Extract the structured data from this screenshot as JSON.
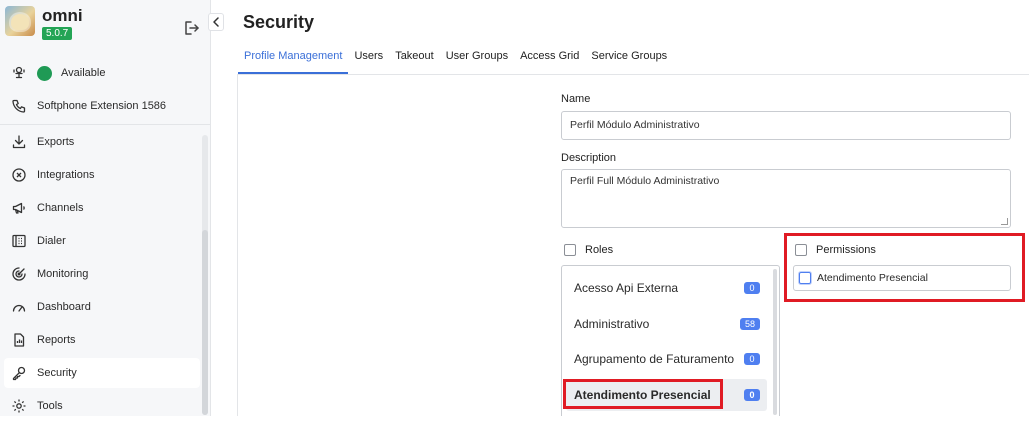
{
  "app": {
    "name": "omni",
    "version": "5.0.7"
  },
  "sidebar": {
    "status": {
      "label": "Available",
      "color": "#1f9a55"
    },
    "extension": {
      "label": "Softphone Extension 1586"
    },
    "items": [
      {
        "label": "Exports",
        "icon": "download-icon"
      },
      {
        "label": "Integrations",
        "icon": "integrations-icon"
      },
      {
        "label": "Channels",
        "icon": "megaphone-icon"
      },
      {
        "label": "Dialer",
        "icon": "dialer-icon"
      },
      {
        "label": "Monitoring",
        "icon": "monitoring-icon"
      },
      {
        "label": "Dashboard",
        "icon": "dashboard-icon"
      },
      {
        "label": "Reports",
        "icon": "reports-icon"
      },
      {
        "label": "Security",
        "icon": "key-icon",
        "active": true
      },
      {
        "label": "Tools",
        "icon": "gear-icon"
      }
    ]
  },
  "page": {
    "title": "Security",
    "tabs": [
      {
        "label": "Profile Management",
        "active": true
      },
      {
        "label": "Users"
      },
      {
        "label": "Takeout"
      },
      {
        "label": "User Groups"
      },
      {
        "label": "Access Grid"
      },
      {
        "label": "Service Groups"
      }
    ]
  },
  "form": {
    "name_label": "Name",
    "name_value": "Perfil Módulo Administrativo",
    "description_label": "Description",
    "description_value": "Perfil Full Módulo Administrativo",
    "roles_label": "Roles",
    "permissions_label": "Permissions",
    "roles": [
      {
        "label": "Acesso Api Externa",
        "count": "0"
      },
      {
        "label": "Administrativo",
        "count": "58"
      },
      {
        "label": "Agrupamento de Faturamento",
        "count": "0"
      },
      {
        "label": "Atendimento Presencial",
        "count": "0",
        "selected": true
      }
    ],
    "permissions": [
      {
        "label": "Atendimento Presencial"
      }
    ]
  },
  "colors": {
    "accent": "#3a6fd8",
    "badge": "#4f7ff0",
    "highlight": "#e01b24",
    "version_badge": "#23a455"
  }
}
